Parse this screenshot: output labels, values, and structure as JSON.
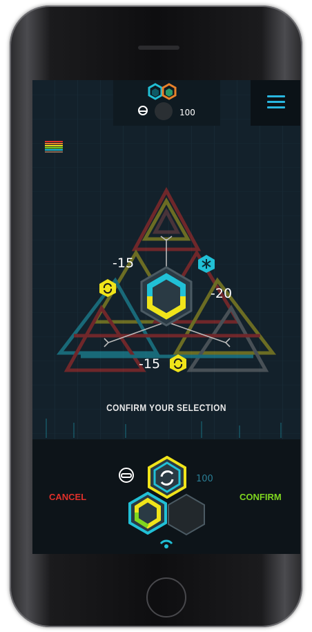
{
  "header": {
    "top_counter": "100"
  },
  "board": {
    "value_top_left": "-15",
    "value_right": "-20",
    "value_bottom": "-15"
  },
  "message": "CONFIRM YOUR SELECTION",
  "actions": {
    "cancel_label": "CANCEL",
    "confirm_label": "CONFIRM"
  },
  "selection": {
    "count": "100"
  },
  "colors": {
    "cyan": "#21c0d6",
    "yellow": "#f0e41a",
    "orange": "#e8822a",
    "cancel": "#e0302a",
    "confirm": "#7fd61f"
  }
}
